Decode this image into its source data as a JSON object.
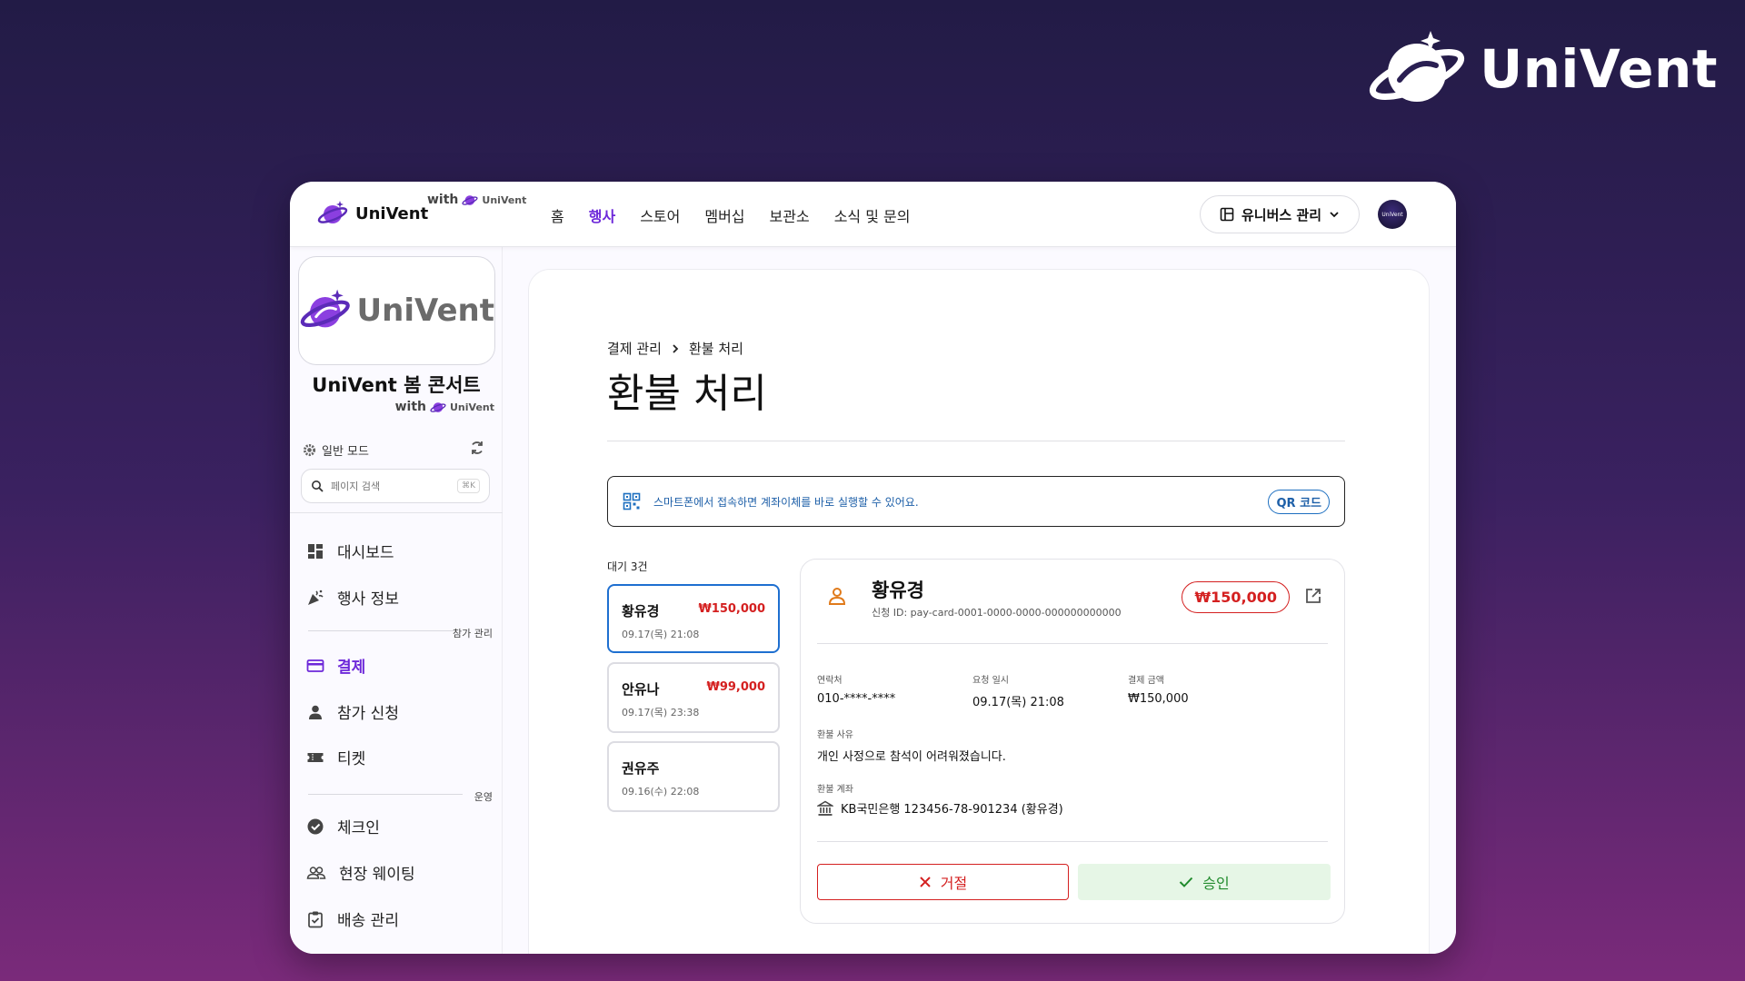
{
  "brand": {
    "name": "UniVent"
  },
  "topbar": {
    "logo_text": "UniVent",
    "with_text": "with",
    "with_brand": "UniVent",
    "nav": [
      "홈",
      "행사",
      "스토어",
      "멤버십",
      "보관소",
      "소식 및 문의"
    ],
    "nav_active_index": 1,
    "admin_label": "유니버스 관리",
    "avatar_text": "UniVent"
  },
  "sidebar": {
    "event_logo_text": "UniVent",
    "event_name": "UniVent 봄 콘서트",
    "with_text": "with",
    "with_brand": "UniVent",
    "mode_label": "일반 모드",
    "search_placeholder": "페이지 검색",
    "search_shortcut": "⌘K",
    "items": [
      {
        "label": "대시보드",
        "icon": "dashboard-icon"
      },
      {
        "label": "행사 정보",
        "icon": "party-icon"
      },
      {
        "label": "결제",
        "icon": "credit-card-icon",
        "active": true
      },
      {
        "label": "참가 신청",
        "icon": "person-icon"
      },
      {
        "label": "티켓",
        "icon": "ticket-icon"
      },
      {
        "label": "체크인",
        "icon": "check-circle-icon"
      },
      {
        "label": "현장 웨이팅",
        "icon": "group-icon"
      },
      {
        "label": "배송 관리",
        "icon": "clipboard-icon"
      }
    ],
    "group_participation": "참가 관리",
    "group_operation": "운영"
  },
  "main": {
    "breadcrumb": [
      "결제 관리",
      "환불 처리"
    ],
    "title": "환불 처리",
    "banner_message": "스마트폰에서 접속하면 계좌이체를 바로 실행할 수 있어요.",
    "qr_button": "QR 코드",
    "waiting_label": "대기 3건",
    "requests": [
      {
        "name": "황유경",
        "amount": "₩150,000",
        "date": "09.17(목) 21:08",
        "selected": true
      },
      {
        "name": "안유나",
        "amount": "₩99,000",
        "date": "09.17(목) 23:38"
      },
      {
        "name": "권유주",
        "amount": "",
        "date": "09.16(수) 22:08"
      }
    ],
    "detail": {
      "name": "황유경",
      "request_id": "신청 ID: pay-card-0001-0000-0000-000000000000",
      "amount": "₩150,000",
      "contact_label": "연락처",
      "contact_value": "010-****-****",
      "request_time_label": "요청 일시",
      "request_time_value": "09.17(목) 21:08",
      "payment_amount_label": "결제 금액",
      "payment_amount_value": "₩150,000",
      "reason_label": "환불 사유",
      "reason_value": "개인 사정으로 참석이 어려워졌습니다.",
      "account_label": "환불 계좌",
      "account_value": "KB국민은행 123456-78-901234 (황유경)",
      "reject_label": "거절",
      "approve_label": "승인"
    }
  },
  "colors": {
    "accent": "#6d28d9",
    "danger": "#d42020",
    "success": "#1f8a2b",
    "info": "#1d5fa8",
    "selected_border": "#1e6fd0"
  }
}
